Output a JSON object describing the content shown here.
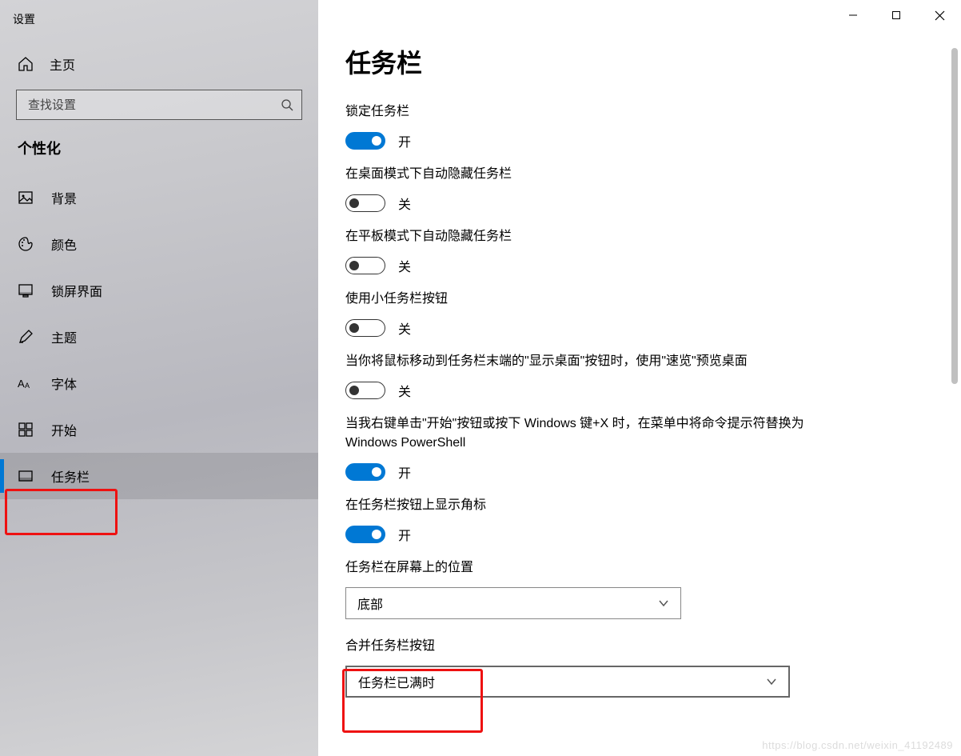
{
  "app_title": "设置",
  "home_label": "主页",
  "search": {
    "placeholder": "查找设置"
  },
  "category": "个性化",
  "sidebar": {
    "items": [
      {
        "label": "背景",
        "icon": "image-icon"
      },
      {
        "label": "颜色",
        "icon": "palette-icon"
      },
      {
        "label": "锁屏界面",
        "icon": "lockscreen-icon"
      },
      {
        "label": "主题",
        "icon": "brush-icon"
      },
      {
        "label": "字体",
        "icon": "font-icon"
      },
      {
        "label": "开始",
        "icon": "start-icon"
      },
      {
        "label": "任务栏",
        "icon": "taskbar-icon",
        "selected": true
      }
    ]
  },
  "page": {
    "title": "任务栏",
    "toggles": [
      {
        "label": "锁定任务栏",
        "on": true
      },
      {
        "label": "在桌面模式下自动隐藏任务栏",
        "on": false
      },
      {
        "label": "在平板模式下自动隐藏任务栏",
        "on": false
      },
      {
        "label": "使用小任务栏按钮",
        "on": false
      },
      {
        "label": "当你将鼠标移动到任务栏末端的\"显示桌面\"按钮时，使用\"速览\"预览桌面",
        "on": false
      },
      {
        "label": "当我右键单击\"开始\"按钮或按下 Windows 键+X 时，在菜单中将命令提示符替换为 Windows PowerShell",
        "on": true
      },
      {
        "label": "在任务栏按钮上显示角标",
        "on": true
      }
    ],
    "state_on": "开",
    "state_off": "关",
    "position": {
      "label": "任务栏在屏幕上的位置",
      "value": "底部"
    },
    "combine": {
      "label": "合并任务栏按钮",
      "value": "任务栏已满时"
    }
  },
  "watermark": "https://blog.csdn.net/weixin_41192489"
}
